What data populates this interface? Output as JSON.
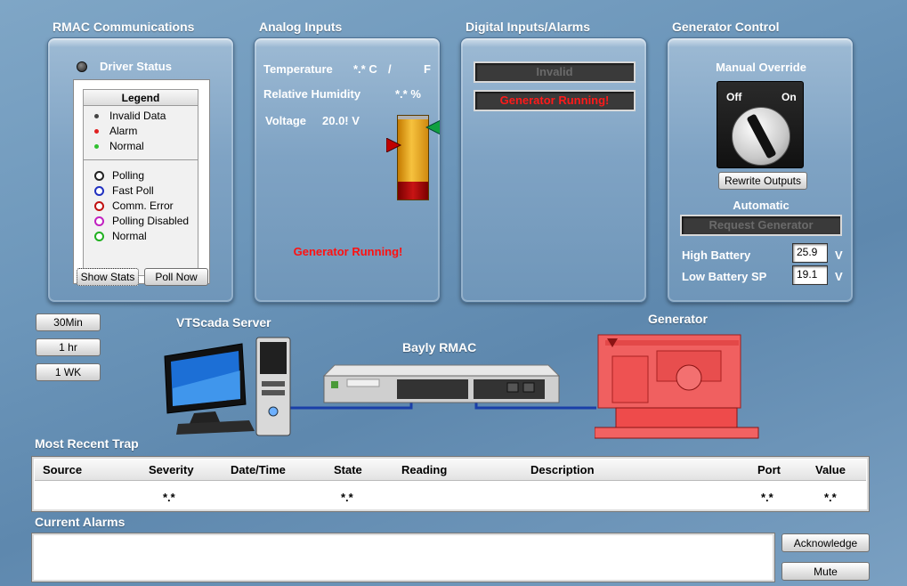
{
  "rmac": {
    "title": "RMAC Communications",
    "driver_status": "Driver Status",
    "legend": {
      "title": "Legend",
      "data_items": [
        {
          "label": "Invalid Data",
          "color": "#444444"
        },
        {
          "label": "Alarm",
          "color": "#e02020"
        },
        {
          "label": "Normal",
          "color": "#30c030"
        }
      ],
      "poll_items": [
        {
          "label": "Polling",
          "color": "#222222"
        },
        {
          "label": "Fast Poll",
          "color": "#2030c0"
        },
        {
          "label": "Comm. Error",
          "color": "#c01010"
        },
        {
          "label": "Polling Disabled",
          "color": "#c020c0"
        },
        {
          "label": "Normal",
          "color": "#20b020"
        }
      ]
    },
    "show_stats": "Show Stats",
    "poll_now": "Poll Now"
  },
  "analog": {
    "title": "Analog Inputs",
    "temperature_label": "Temperature",
    "temperature_c": "*.* C",
    "temperature_sep": "/",
    "temperature_f": "F",
    "humidity_label": "Relative Humidity",
    "humidity_value": "*.* %",
    "voltage_label": "Voltage",
    "voltage_value": "20.0! V",
    "generator_msg": "Generator Running!"
  },
  "digital": {
    "title": "Digital Inputs/Alarms",
    "invalid": "Invalid",
    "generator_running": "Generator Running!"
  },
  "gen_control": {
    "title": "Generator Control",
    "manual_override": "Manual Override",
    "off": "Off",
    "on": "On",
    "rewrite_outputs": "Rewrite Outputs",
    "automatic": "Automatic",
    "request_generator": "Request Generator",
    "high_battery_label": "High Battery",
    "high_battery_value": "25.9",
    "low_battery_label": "Low Battery SP",
    "low_battery_value": "19.1",
    "unit": "V"
  },
  "time_buttons": [
    "30Min",
    "1 hr",
    "1 WK"
  ],
  "network": {
    "server_label": "VTScada Server",
    "rmac_label": "Bayly RMAC",
    "generator_label": "Generator"
  },
  "trap": {
    "title": "Most Recent Trap",
    "headers": [
      "Source",
      "Severity",
      "Date/Time",
      "State",
      "Reading",
      "Description",
      "Port",
      "Value"
    ],
    "values": [
      "",
      "*.*",
      "",
      "*.*",
      "",
      "",
      "*.*",
      "*.*"
    ]
  },
  "alarms": {
    "title": "Current Alarms",
    "acknowledge": "Acknowledge",
    "mute": "Mute"
  },
  "colors": {
    "alarm_red": "#ff1010",
    "generator_body": "#f06060"
  }
}
